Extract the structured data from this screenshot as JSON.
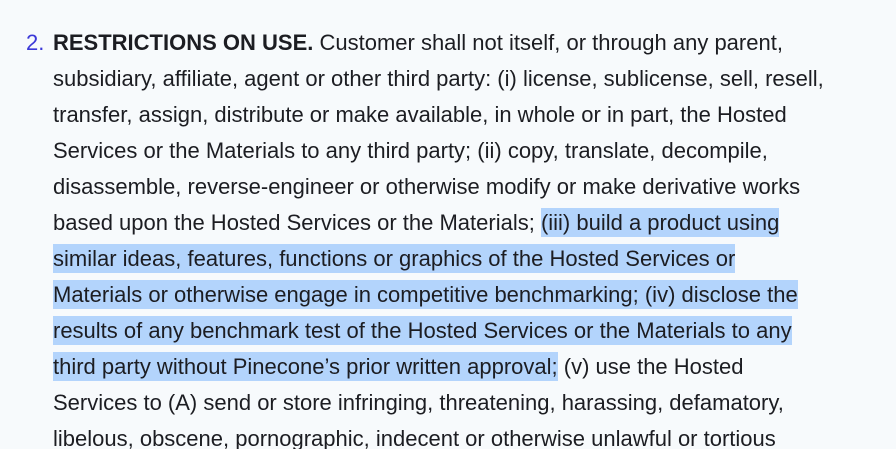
{
  "section": {
    "number": "2.",
    "heading": "RESTRICTIONS ON USE.",
    "lines": [
      {
        "before": " Customer shall not itself, or through any parent,",
        "highlight": "",
        "after": ""
      },
      {
        "before": "subsidiary, affiliate, agent or other third party: (i) license, sublicense, sell, resell,",
        "highlight": "",
        "after": ""
      },
      {
        "before": "transfer, assign, distribute or make available, in whole or in part, the Hosted",
        "highlight": "",
        "after": ""
      },
      {
        "before": "Services or the Materials to any third party; (ii) copy, translate, decompile,",
        "highlight": "",
        "after": ""
      },
      {
        "before": "disassemble, reverse-engineer or otherwise modify or make derivative works",
        "highlight": "",
        "after": ""
      },
      {
        "before": "based upon the Hosted Services or the Materials; ",
        "highlight": "(iii) build a product using",
        "after": ""
      },
      {
        "before": "",
        "highlight": "similar ideas, features, functions or graphics of the Hosted Services or",
        "after": ""
      },
      {
        "before": "",
        "highlight": "Materials or otherwise engage in competitive benchmarking; (iv) disclose the",
        "after": ""
      },
      {
        "before": "",
        "highlight": "results of any benchmark test of the Hosted Services or the Materials to any",
        "after": ""
      },
      {
        "before": "",
        "highlight": "third party without Pinecone’s prior written approval;",
        "after": " (v) use the Hosted"
      },
      {
        "before": "Services to (A) send or store infringing, threatening, harassing, defamatory,",
        "highlight": "",
        "after": ""
      },
      {
        "before": "libelous, obscene, pornographic, indecent or otherwise unlawful or tortious",
        "highlight": "",
        "after": ""
      }
    ]
  }
}
